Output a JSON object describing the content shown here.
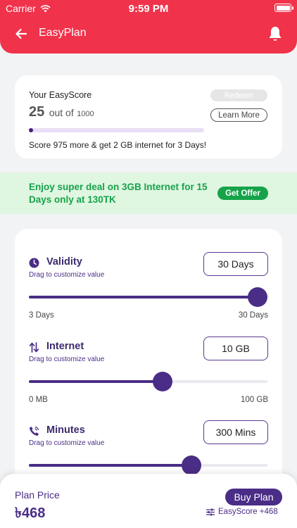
{
  "status_bar": {
    "carrier": "Carrier",
    "time": "9:59 PM"
  },
  "header": {
    "title": "EasyPlan"
  },
  "score_card": {
    "heading": "Your EasyScore",
    "score": "25",
    "out_of": "out of",
    "max": "1000",
    "progress_fraction": 0.025,
    "redeem_label": "Redeem",
    "learn_more_label": "Learn More",
    "note": "Score 975 more & get 2 GB internet for 3 Days!"
  },
  "offer": {
    "text": "Enjoy super deal on 3GB Internet for 15 Days only at 130TK",
    "button_label": "Get Offer"
  },
  "customizers": [
    {
      "id": "validity",
      "icon": "clock-icon",
      "title": "Validity",
      "hint": "Drag to customize value",
      "value": "30 Days",
      "min_label": "3 Days",
      "max_label": "30 Days",
      "fraction": 0.96
    },
    {
      "id": "internet",
      "icon": "up-down-arrows-icon",
      "title": "Internet",
      "hint": "Drag to customize value",
      "value": "10 GB",
      "min_label": "0 MB",
      "max_label": "100 GB",
      "fraction": 0.56
    },
    {
      "id": "minutes",
      "icon": "phone-icon",
      "title": "Minutes",
      "hint": "Drag to customize value",
      "value": "300 Mins",
      "min_label": "",
      "max_label": "",
      "fraction": 0.68
    }
  ],
  "bottom_bar": {
    "price_label": "Plan Price",
    "price_value": "৳468",
    "buy_label": "Buy Plan",
    "bonus_text": "EasyScore +468"
  },
  "colors": {
    "header": "#f0324b",
    "accent": "#4a2d86",
    "offer_green": "#16a34a"
  }
}
